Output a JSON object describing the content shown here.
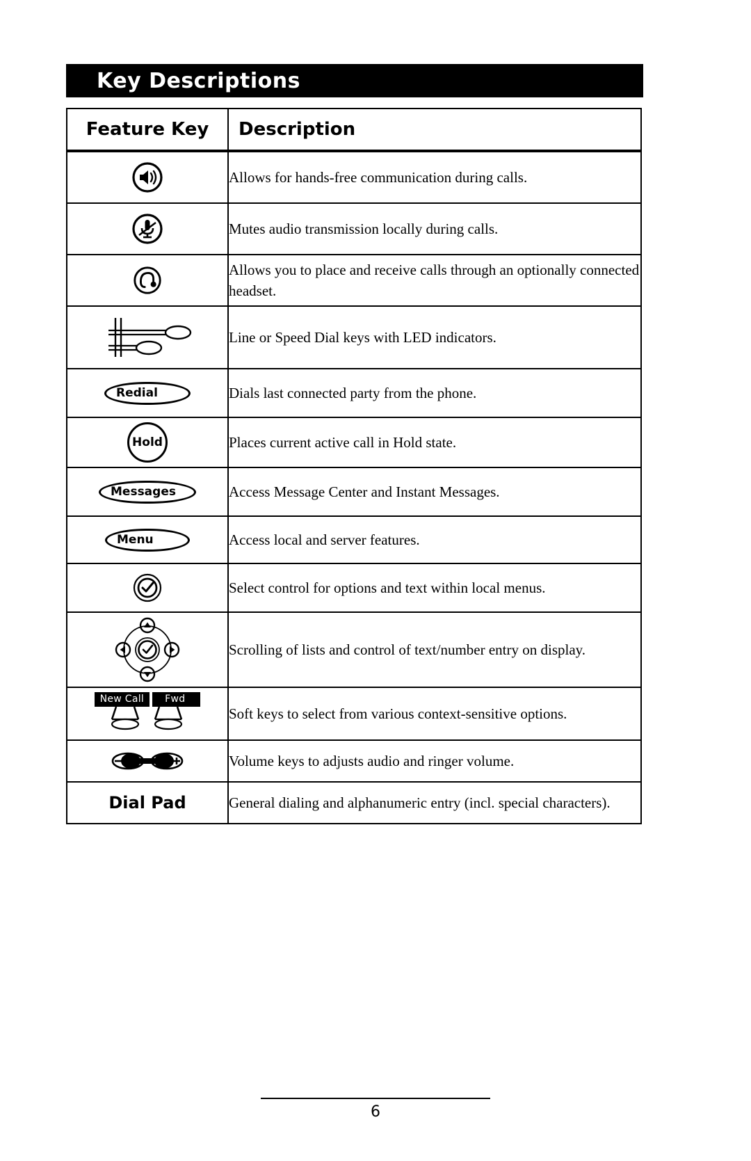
{
  "page": {
    "banner_title": "Key Descriptions",
    "footer_page_number": "6"
  },
  "table": {
    "headers": {
      "feature_key": "Feature Key",
      "description": "Description"
    },
    "rows": [
      {
        "icon": "speakerphone-icon",
        "key_label": "",
        "description": "Allows for hands-free communication during calls."
      },
      {
        "icon": "mute-microphone-icon",
        "key_label": "",
        "description": "Mutes audio transmission locally during calls."
      },
      {
        "icon": "headset-icon",
        "key_label": "",
        "description": "Allows you to place and receive calls through an optionally connected headset."
      },
      {
        "icon": "line-speed-dial-keys-icon",
        "key_label": "",
        "description": "Line or Speed Dial keys with LED indicators."
      },
      {
        "icon": "redial-key-icon",
        "key_label": "Redial",
        "description": "Dials last connected party from the phone."
      },
      {
        "icon": "hold-key-icon",
        "key_label": "Hold",
        "description": "Places current active call in Hold state."
      },
      {
        "icon": "messages-key-icon",
        "key_label": "Messages",
        "description": "Access Message Center and Instant Messages."
      },
      {
        "icon": "menu-key-icon",
        "key_label": "Menu",
        "description": "Access local and server features."
      },
      {
        "icon": "select-checkmark-icon",
        "key_label": "",
        "description": "Select control for options and text within local menus."
      },
      {
        "icon": "navigation-cluster-icon",
        "key_label": "",
        "description": "Scrolling of lists and control of text/number entry on display."
      },
      {
        "icon": "soft-keys-icon",
        "key_label": "",
        "softkey_labels": [
          "New Call",
          "Fwd"
        ],
        "description": "Soft keys to select from various context-sensitive options."
      },
      {
        "icon": "volume-keys-icon",
        "key_label": "",
        "volume_minus": "–",
        "volume_plus": "+",
        "description": "Volume keys to adjusts audio and ringer volume."
      },
      {
        "icon": "dial-pad-label",
        "key_label": "Dial Pad",
        "description": "General dialing and alphanumeric entry (incl. special characters)."
      }
    ]
  },
  "colors": {
    "ink": "#000000",
    "paper": "#ffffff"
  }
}
